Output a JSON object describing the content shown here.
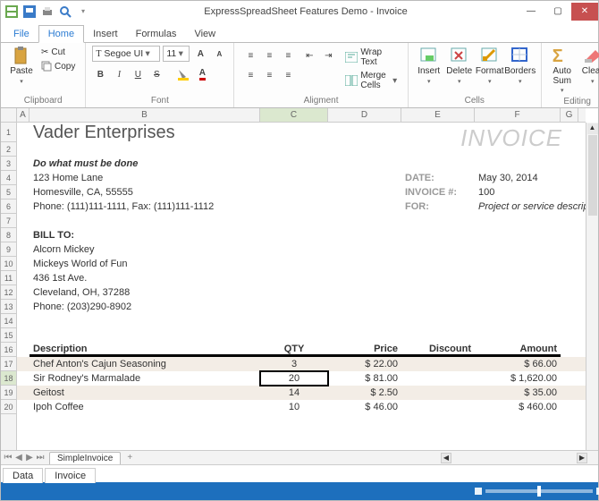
{
  "window": {
    "title": "ExpressSpreadSheet  Features Demo - Invoice",
    "tabs": {
      "file": "File",
      "home": "Home",
      "insert": "Insert",
      "formulas": "Formulas",
      "view": "View"
    }
  },
  "ribbon": {
    "clipboard": {
      "label": "Clipboard",
      "paste": "Paste",
      "cut": "Cut",
      "copy": "Copy"
    },
    "font": {
      "label": "Font",
      "name": "Segoe UI",
      "size": "11"
    },
    "alignment": {
      "label": "Aligment",
      "wrap": "Wrap Text",
      "merge": "Merge Cells"
    },
    "cells": {
      "label": "Cells",
      "insert": "Insert",
      "delete": "Delete",
      "format": "Format",
      "borders": "Borders"
    },
    "editing": {
      "label": "Editing",
      "autosum": "Auto Sum",
      "clear": "Clear"
    }
  },
  "columns": [
    "A",
    "B",
    "C",
    "D",
    "E",
    "F",
    "G"
  ],
  "invoice": {
    "watermark": "INVOICE",
    "company": "Vader Enterprises",
    "slogan": "Do what must be done",
    "addr1": "123 Home Lane",
    "addr2": "Homesville, CA, 55555",
    "phone": "Phone: (111)111-1111, Fax: (111)111-1112",
    "date_lbl": "DATE:",
    "date": "May 30, 2014",
    "invno_lbl": "INVOICE #:",
    "invno": "100",
    "for_lbl": "FOR:",
    "for": "Project or service description",
    "billto": "BILL TO:",
    "b1": "Alcorn Mickey",
    "b2": "Mickeys World of Fun",
    "b3": "436 1st Ave.",
    "b4": "Cleveland, OH, 37288",
    "b5": "Phone: (203)290-8902",
    "hdr": {
      "desc": "Description",
      "qty": "QTY",
      "price": "Price",
      "disc": "Discount",
      "amt": "Amount"
    },
    "rows": [
      {
        "desc": "Chef Anton's Cajun Seasoning",
        "qty": "3",
        "price": "$ 22.00",
        "amt": "$ 66.00"
      },
      {
        "desc": "Sir Rodney's Marmalade",
        "qty": "20",
        "price": "$ 81.00",
        "amt": "$ 1,620.00"
      },
      {
        "desc": "Geitost",
        "qty": "14",
        "price": "$ 2.50",
        "amt": "$ 35.00"
      },
      {
        "desc": "Ipoh Coffee",
        "qty": "10",
        "price": "$ 46.00",
        "amt": "$ 460.00"
      }
    ]
  },
  "sheet_tab": "SimpleInvoice",
  "page_tabs": {
    "data": "Data",
    "invoice": "Invoice"
  }
}
